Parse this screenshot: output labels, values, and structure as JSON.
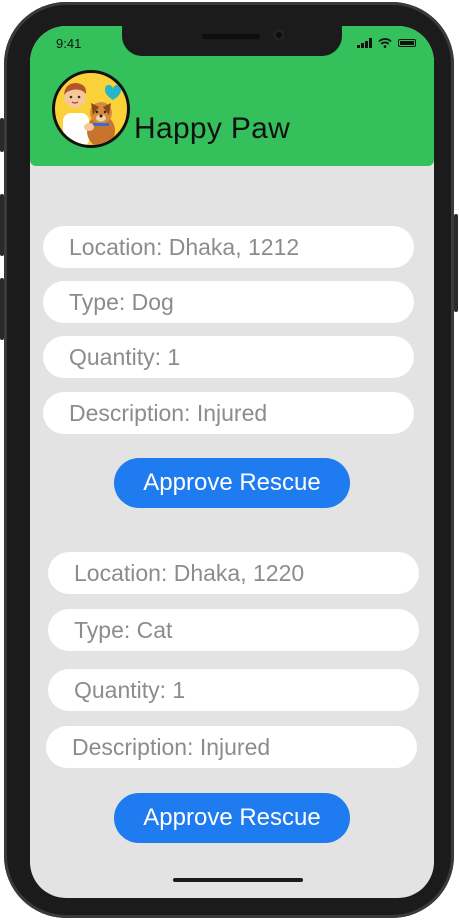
{
  "status_bar": {
    "time": "9:41",
    "icons": [
      "signal-icon",
      "wifi-icon",
      "battery-icon"
    ]
  },
  "app": {
    "title": "Happy Paw",
    "logo_icon": "avatar-person-dog-icon",
    "header_color": "#34c05a"
  },
  "colors": {
    "accent": "#1e7bf0",
    "background": "#e3e3e3"
  },
  "requests": [
    {
      "location": "Location: Dhaka, 1212",
      "type": "Type: Dog",
      "quantity": "Quantity: 1",
      "description": "Description: Injured",
      "action_label": "Approve Rescue"
    },
    {
      "location": "Location: Dhaka, 1220",
      "type": "Type: Cat",
      "quantity": "Quantity: 1",
      "description": "Description: Injured",
      "action_label": "Approve Rescue"
    }
  ]
}
